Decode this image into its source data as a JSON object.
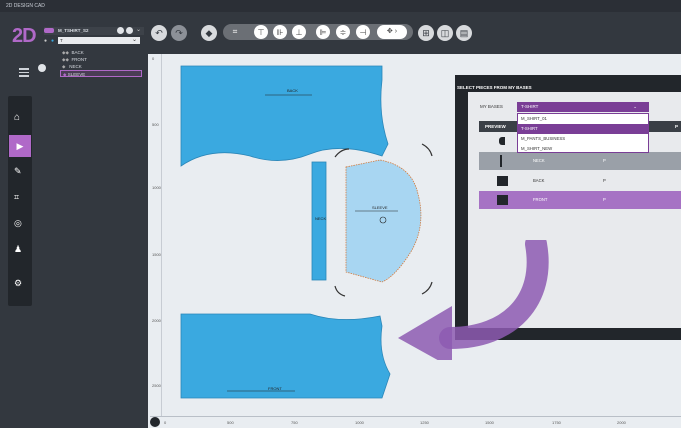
{
  "window": {
    "title": "2D DESIGN CAD"
  },
  "app": {
    "logo": "2D"
  },
  "tree": {
    "root": "M_TSHIRT_S2",
    "child": "T",
    "items": [
      "BACK",
      "FRONT",
      "NECK",
      "SLEEVE"
    ]
  },
  "pieces": {
    "back": "BACK",
    "front": "FRONT",
    "sleeve": "SLEEVE",
    "neck": "NECK"
  },
  "rulers": {
    "horizontal": [
      "0",
      "500",
      "750",
      "1000",
      "1250",
      "1500",
      "1750",
      "2000"
    ],
    "vertical": [
      "0",
      "500",
      "1000",
      "1500",
      "2000",
      "2500"
    ]
  },
  "dialog": {
    "title": "SELECT PIECES FROM MY BASES",
    "my_bases_label": "MY BASES",
    "selected_base": "T-SHIRT",
    "options": [
      "M_SHIRT_01",
      "T-SHIRT",
      "M_PANTS_BUSINESS",
      "M_SHIRT_NEW"
    ],
    "columns": [
      "PREVIEW",
      "",
      "",
      "P"
    ],
    "rows": [
      {
        "name": "",
        "qty": ""
      },
      {
        "name": "NECK",
        "qty": "P"
      },
      {
        "name": "BACK",
        "qty": "P"
      },
      {
        "name": "FRONT",
        "qty": "P"
      }
    ]
  },
  "colors": {
    "accent": "#7a3e96",
    "piece_blue": "#3aa9e0",
    "piece_light": "#a8d6f2",
    "arrow": "#8d5ab2"
  }
}
